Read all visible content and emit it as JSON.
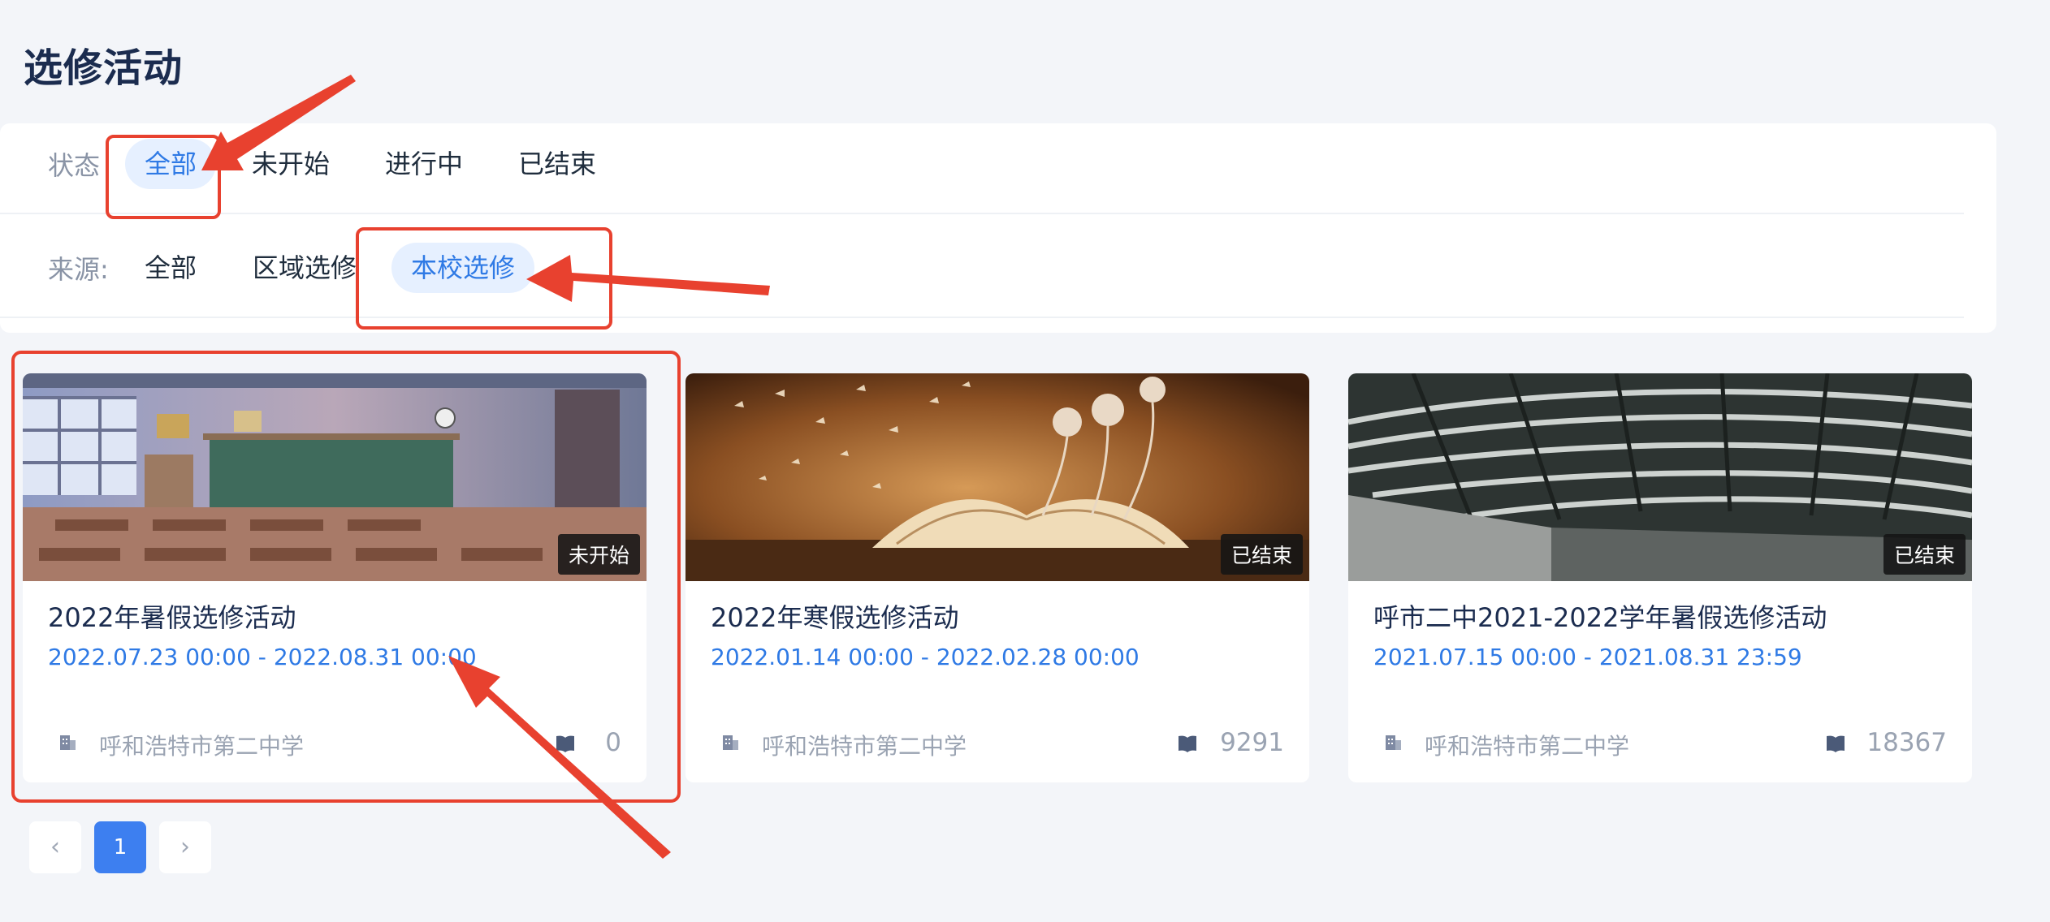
{
  "page_title": "选修活动",
  "filters": {
    "status": {
      "label": "状态",
      "options": [
        "全部",
        "未开始",
        "进行中",
        "已结束"
      ],
      "selected": "全部"
    },
    "source": {
      "label": "来源:",
      "options": [
        "全部",
        "区域选修",
        "本校选修"
      ],
      "selected": "本校选修"
    }
  },
  "cards": [
    {
      "title": "2022年暑假选修活动",
      "date_range": "2022.07.23 00:00 - 2022.08.31 00:00",
      "status": "未开始",
      "school": "呼和浩特市第二中学",
      "count": "0"
    },
    {
      "title": "2022年寒假选修活动",
      "date_range": "2022.01.14 00:00 - 2022.02.28 00:00",
      "status": "已结束",
      "school": "呼和浩特市第二中学",
      "count": "9291"
    },
    {
      "title": "呼市二中2021-2022学年暑假选修活动",
      "date_range": "2021.07.15 00:00 - 2021.08.31 23:59",
      "status": "已结束",
      "school": "呼和浩特市第二中学",
      "count": "18367"
    }
  ],
  "pagination": {
    "prev": "‹",
    "current": "1",
    "next": "›"
  },
  "colors": {
    "accent": "#2f7ae5",
    "annotation": "#e8412f",
    "title": "#1b2c4f"
  },
  "icons": [
    "building-icon",
    "book-icon",
    "chevron-left-icon",
    "chevron-right-icon"
  ]
}
